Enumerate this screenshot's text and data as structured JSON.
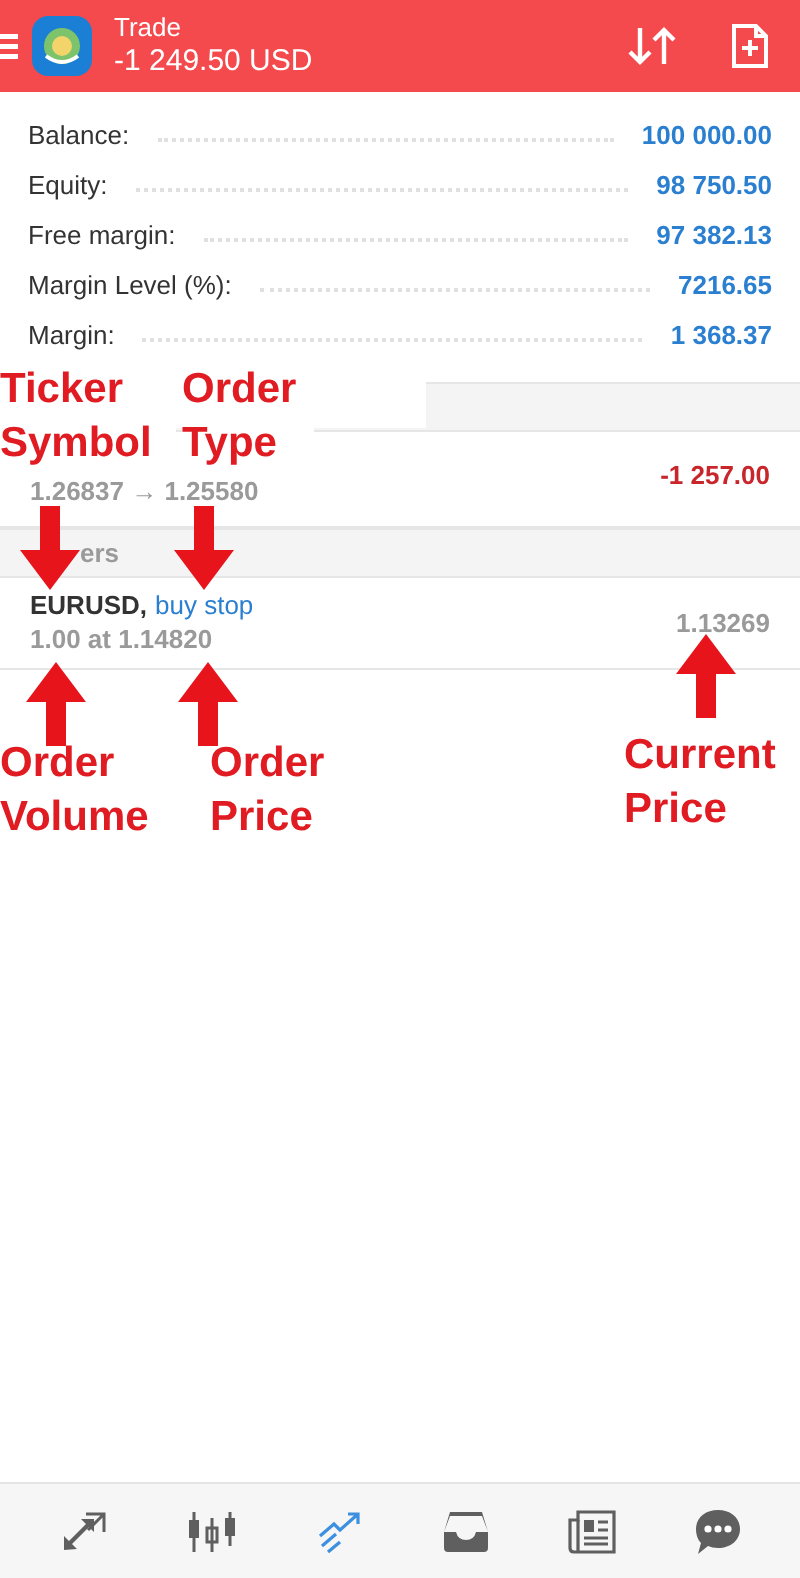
{
  "header": {
    "title": "Trade",
    "profit": "-1 249.50 USD"
  },
  "summary": [
    {
      "label": "Balance:",
      "value": "100 000.00"
    },
    {
      "label": "Equity:",
      "value": "98 750.50"
    },
    {
      "label": "Free margin:",
      "value": "97 382.13"
    },
    {
      "label": "Margin Level (%):",
      "value": "7216.65"
    },
    {
      "label": "Margin:",
      "value": "1 368.37"
    }
  ],
  "positions": [
    {
      "prices": "1.26837 → 1.25580",
      "profit": "-1 257.00"
    }
  ],
  "orders_section": {
    "title": "ers"
  },
  "orders": [
    {
      "symbol": "EURUSD,",
      "type": "buy stop",
      "volume_price": "1.00 at 1.14820",
      "current_price": "1.13269"
    }
  ],
  "annotations": [
    {
      "label": "Ticker Symbol",
      "kind": "down"
    },
    {
      "label": "Order Type",
      "kind": "down"
    },
    {
      "label": "Order Volume",
      "kind": "up"
    },
    {
      "label": "Order Price",
      "kind": "up"
    },
    {
      "label": "Current Price",
      "kind": "up"
    }
  ],
  "nav": [
    {
      "kind": "quotes",
      "selected": false
    },
    {
      "kind": "chart",
      "selected": false
    },
    {
      "kind": "trade",
      "selected": true
    },
    {
      "kind": "inbox",
      "selected": false
    },
    {
      "kind": "news",
      "selected": false
    },
    {
      "kind": "chat",
      "selected": false
    }
  ]
}
